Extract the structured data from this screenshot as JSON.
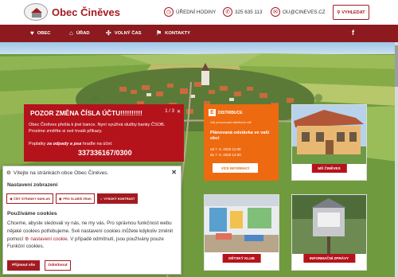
{
  "header": {
    "brand": "Obec Činěves",
    "hours_label": "ÚŘEDNÍ HODINY",
    "phone": "325 635 113",
    "email": "OU@CINEVES.CZ",
    "search_label": "VYHLEDAT",
    "accent_color": "#a31b21"
  },
  "nav": {
    "items": [
      {
        "label": "OBEC",
        "icon": "heart-icon"
      },
      {
        "label": "ÚŘAD",
        "icon": "building-icon"
      },
      {
        "label": "VOLNÝ ČAS",
        "icon": "puzzle-icon"
      },
      {
        "label": "KONTAKTY",
        "icon": "flag-icon"
      }
    ],
    "facebook": "f",
    "background": "#8c1a1f"
  },
  "notice": {
    "title": "POZOR ZMĚNA ČÍSLA ÚČTU!!!!!!!!!!",
    "pager": "1 / 3",
    "body": "Obec Činěves přešla k jiné bance. Nyní využívá služby banky ČSOB. Prosíme změňte si své trvalé příkazy.",
    "payments_prefix": "Poplatky ",
    "payments_bold": "za odpady a psa",
    "payments_suffix": " hraďte na účet:",
    "account": "337336167/0300",
    "background": "#b5131c"
  },
  "distribuce": {
    "brand": "DISTRIBUCE",
    "sub": "Váš provozovatel distribuční sítě",
    "headline": "Plánovaná odstávka ve vaší obci",
    "date_from": "od 7. 6. 2026 11:00",
    "date_to": "do 7. 6. 2026 14:00",
    "button": "VÍCE INFORMACÍ",
    "color": "#ee6a10"
  },
  "tiles": {
    "mesto": "MŠ ČINĚVES",
    "klub": "DĚTSKÝ KLUB",
    "info": "INFORMAČNÍ ZPRÁVY"
  },
  "cookie": {
    "welcome": "Vítejte na stránkách obce Obec Činěves.",
    "display_heading": "Nastavení zobrazení",
    "btn_read": "ČÍST STRÁNKY NAHLAS",
    "btn_poor": "PRO SLABŠÍ ZRAK",
    "btn_contrast": "VYSOKÝ KONTRAST",
    "cookies_heading": "Používáme cookies",
    "text_1": "Chceme, abyste sledovali vy nás, ne my vás. Pro správnou funkčnost webu nějaké cookies potřebujeme. Své nastavení cookies můžete kdykoliv změnit pomocí ",
    "text_link": "nastavení cookie",
    "text_2": ". V případě odmítnutí, jsou používány pouze Funkční cookies.",
    "accept": "Přijmout vše",
    "reject": "Odmítnout"
  }
}
